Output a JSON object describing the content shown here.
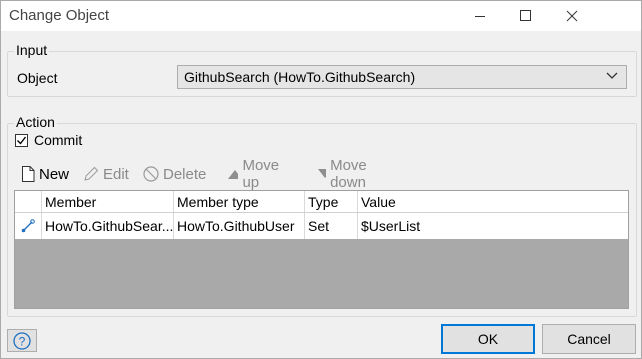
{
  "window": {
    "title": "Change Object"
  },
  "input_group": {
    "label": "Input",
    "object_label": "Object",
    "object_value": "GithubSearch (HowTo.GithubSearch)"
  },
  "action_group": {
    "label": "Action",
    "commit_label": "Commit",
    "commit_checked": true
  },
  "toolbar": {
    "new": "New",
    "edit": "Edit",
    "delete": "Delete",
    "move_up": "Move up",
    "move_down": "Move down"
  },
  "grid": {
    "columns": [
      "Member",
      "Member type",
      "Type",
      "Value"
    ],
    "rows": [
      {
        "member": "HowTo.GithubSear...",
        "member_type": "HowTo.GithubUser",
        "type": "Set",
        "value": "$UserList",
        "icon": "association-icon"
      }
    ]
  },
  "buttons": {
    "ok": "OK",
    "cancel": "Cancel",
    "help_icon": "help-icon"
  },
  "colors": {
    "accent": "#0078d7",
    "grid_empty": "#a9a9a9",
    "icon_blue": "#1e6fc1"
  }
}
